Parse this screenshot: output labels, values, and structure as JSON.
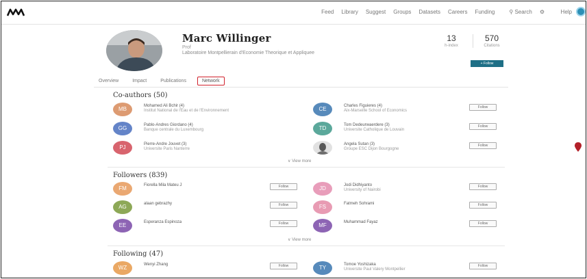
{
  "nav": {
    "links": [
      "Feed",
      "Library",
      "Suggest",
      "Groups",
      "Datasets",
      "Careers",
      "Funding"
    ],
    "search_label": "Search",
    "help_label": "Help"
  },
  "profile": {
    "name": "Marc Willinger",
    "role": "Prof",
    "institution": "Laboratoire Montpellierain d'Economie Theorique et Appliquee",
    "stats": [
      {
        "value": "13",
        "label": "h-index"
      },
      {
        "value": "570",
        "label": "Citations"
      }
    ],
    "follow_label": "+ Follow"
  },
  "tabs": [
    {
      "label": "Overview",
      "active": false
    },
    {
      "label": "Impact",
      "active": false
    },
    {
      "label": "Publications",
      "active": false
    },
    {
      "label": "Network",
      "active": true
    }
  ],
  "coauthors": {
    "title": "Co-authors (50)",
    "people": [
      {
        "initials": "MB",
        "name": "Mohamed Ali Bchir (4)",
        "sub": "Institut National de l'Eau et de l'Environnement",
        "color": "#d88a5a"
      },
      {
        "initials": "CE",
        "name": "Charles Figuieres (4)",
        "sub": "Aix-Marseille School of Economics",
        "color": "#3a76b0"
      },
      {
        "initials": "GG",
        "name": "Pablo-Andres Giordano (4)",
        "sub": "Banque centrale du Luxembourg",
        "color": "#4a6fbf"
      },
      {
        "initials": "TD",
        "name": "Tom Dedeurwaerdere (3)",
        "sub": "Universite Catholique de Louvain",
        "color": "#3f9a8a"
      },
      {
        "initials": "PJ",
        "name": "Pierre-Andre Jouvet (3)",
        "sub": "Universite Paris Nanterre",
        "color": "#d24a55"
      },
      {
        "initials": "",
        "name": "Angela Sutan (3)",
        "sub": "Groupe ESC Dijon Bourgogne",
        "color": "#555555"
      }
    ],
    "follow_label": "Follow",
    "view_more": "View more"
  },
  "followers": {
    "title": "Followers (839)",
    "people": [
      {
        "initials": "FM",
        "name": "Fiorella Mila Mateu J",
        "sub": "",
        "color": "#e79a5a"
      },
      {
        "initials": "JD",
        "name": "Jodi Didhiyanto",
        "sub": "University of Nairobi",
        "color": "#e58cae"
      },
      {
        "initials": "AG",
        "name": "alaan gebrazhy",
        "sub": "",
        "color": "#7a9a3a"
      },
      {
        "initials": "FS",
        "name": "Fatmeh Sohrami",
        "sub": "",
        "color": "#e48aa6"
      },
      {
        "initials": "EE",
        "name": "Esperanza Espinoza",
        "sub": "",
        "color": "#7a4aa8"
      },
      {
        "initials": "MF",
        "name": "Muhammad Fayaz",
        "sub": "",
        "color": "#7a4aa8"
      }
    ],
    "follow_label": "Follow",
    "view_more": "View more"
  },
  "following": {
    "title": "Following (47)",
    "people": [
      {
        "initials": "WZ",
        "name": "Wenyi Zhang",
        "sub": "",
        "color": "#e79a4a"
      },
      {
        "initials": "TY",
        "name": "Tomoe Yoshizaka",
        "sub": "Universite Paul Valery Montpellier",
        "color": "#3a76b0"
      }
    ],
    "follow_label": "Follow"
  }
}
